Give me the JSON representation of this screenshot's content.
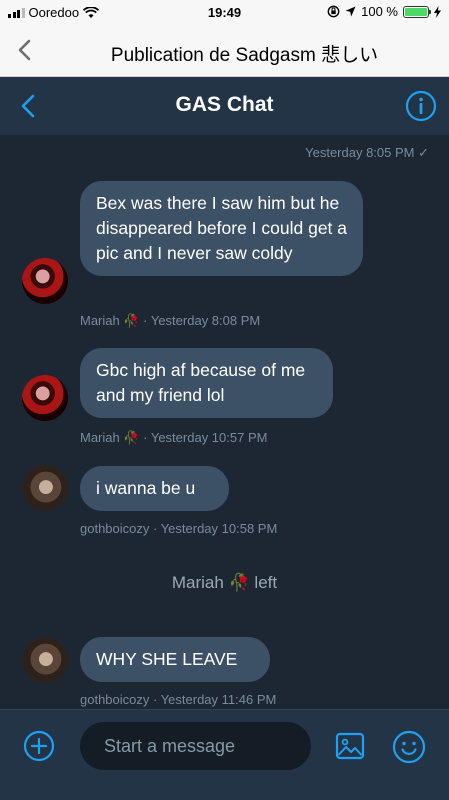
{
  "status_bar": {
    "carrier": "Ooredoo",
    "time": "19:49",
    "battery": "100 %"
  },
  "outer_nav": {
    "title": "Publication de Sadgasm 悲しい"
  },
  "header": {
    "title": "GAS Chat"
  },
  "conversation": {
    "top_timestamp": "Yesterday 8:05 PM ✓",
    "messages": [
      {
        "text": "Bex was there I saw him but he disappeared before I could get a pic and I never saw coldy",
        "meta": "Mariah 🥀 · Yesterday 8:08 PM"
      },
      {
        "text": "Gbc high af because of me and my friend lol",
        "meta": "Mariah 🥀 · Yesterday 10:57 PM"
      },
      {
        "text": "i wanna be u",
        "meta": "gothboicozy · Yesterday 10:58 PM"
      },
      {
        "text": "WHY SHE LEAVE",
        "meta": "gothboicozy · Yesterday 11:46 PM"
      }
    ],
    "system_message": "Mariah 🥀 left"
  },
  "composer": {
    "placeholder": "Start a message"
  },
  "colors": {
    "background": "#1c2733",
    "header": "#243447",
    "bubble": "#3d5166",
    "accent": "#1da1f2",
    "meta_text": "#7a8b9c"
  }
}
